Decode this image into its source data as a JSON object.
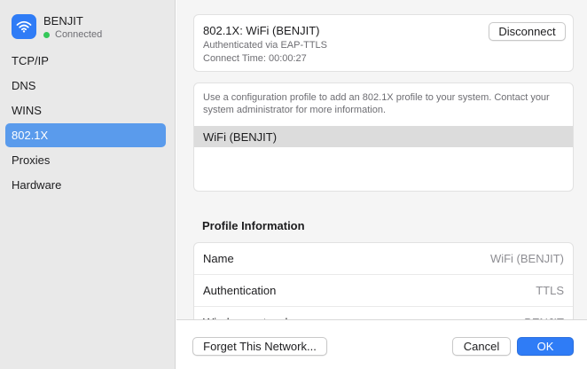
{
  "sidebar": {
    "network": {
      "name": "BENJIT",
      "status": "Connected",
      "status_color": "#34c759"
    },
    "items": [
      {
        "label": "TCP/IP"
      },
      {
        "label": "DNS"
      },
      {
        "label": "WINS"
      },
      {
        "label": "802.1X",
        "selected": true
      },
      {
        "label": "Proxies"
      },
      {
        "label": "Hardware"
      }
    ]
  },
  "status": {
    "title": "802.1X:  WiFi (BENJIT)",
    "auth_line": "Authenticated via EAP-TTLS",
    "time_line": "Connect Time: 00:00:27",
    "disconnect_label": "Disconnect"
  },
  "profile": {
    "description": "Use a configuration profile to add an 802.1X profile to your system. Contact your system administrator for more information.",
    "selected_item": "WiFi (BENJIT)"
  },
  "profile_info": {
    "title": "Profile Information",
    "rows": [
      {
        "label": "Name",
        "value": "WiFi (BENJIT)"
      },
      {
        "label": "Authentication",
        "value": "TTLS"
      },
      {
        "label": "Wireless network",
        "value": "BENJIT"
      }
    ]
  },
  "footer": {
    "forget_label": "Forget This Network...",
    "cancel_label": "Cancel",
    "ok_label": "OK"
  },
  "colors": {
    "accent": "#2f7cf6",
    "selection": "#5a9bec"
  }
}
